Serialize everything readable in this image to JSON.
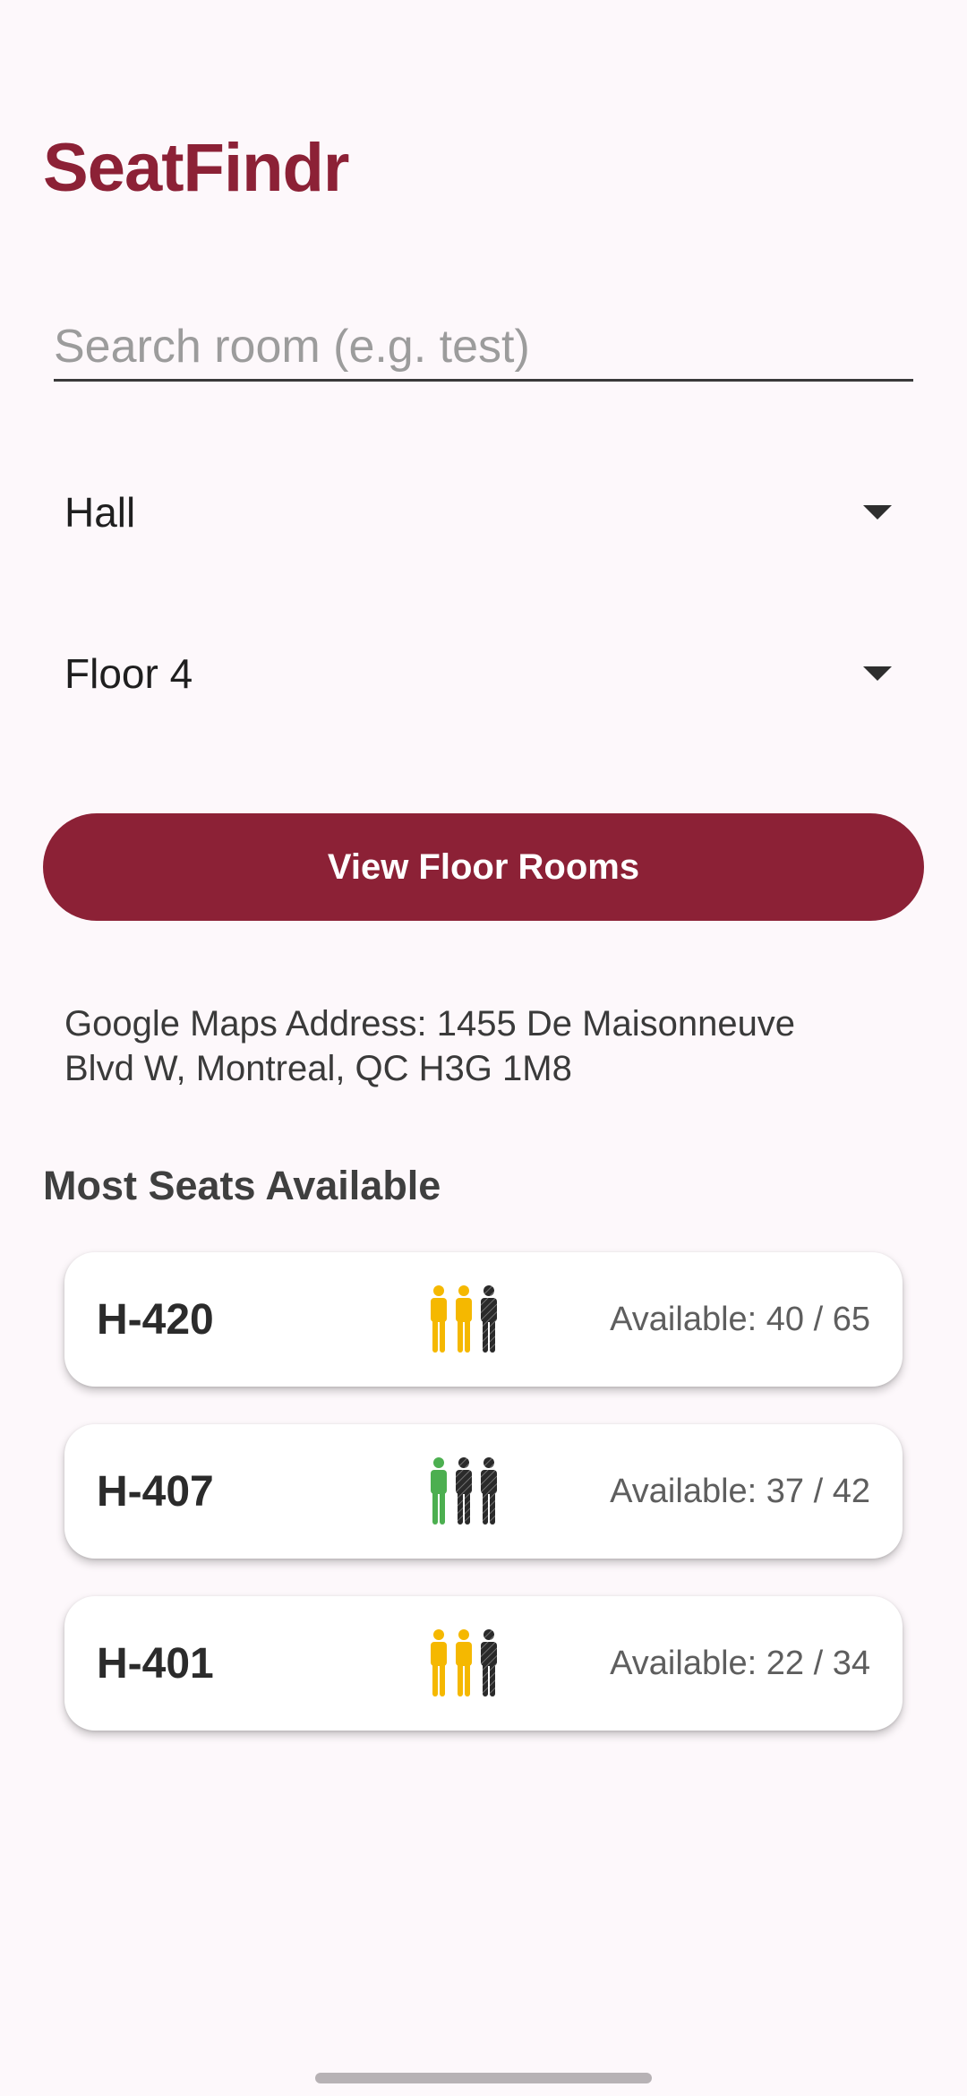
{
  "app": {
    "title": "SeatFindr"
  },
  "search": {
    "placeholder": "Search room (e.g. test)",
    "value": ""
  },
  "filters": {
    "building": "Hall",
    "floor": "Floor 4"
  },
  "actions": {
    "view_floor_rooms": "View Floor Rooms"
  },
  "address": {
    "text": "Google Maps Address: 1455 De Maisonneuve Blvd W, Montreal, QC H3G 1M8"
  },
  "section": {
    "most_seats_title": "Most Seats Available"
  },
  "colors": {
    "brand": "#8c2136",
    "busy_dark": "#2a2a2a",
    "medium_yellow": "#f5b800",
    "low_green": "#4caf50"
  },
  "rooms": [
    {
      "name": "H-420",
      "availability": "Available: 40 / 65",
      "occupancy_icon": [
        "person-yellow-icon",
        "person-yellow-icon",
        "person-dark-hatched-icon"
      ]
    },
    {
      "name": "H-407",
      "availability": "Available: 37 / 42",
      "occupancy_icon": [
        "person-green-icon",
        "person-dark-hatched-icon",
        "person-dark-hatched-icon"
      ]
    },
    {
      "name": "H-401",
      "availability": "Available: 22 / 34",
      "occupancy_icon": [
        "person-yellow-icon",
        "person-yellow-icon",
        "person-dark-hatched-icon"
      ]
    }
  ]
}
